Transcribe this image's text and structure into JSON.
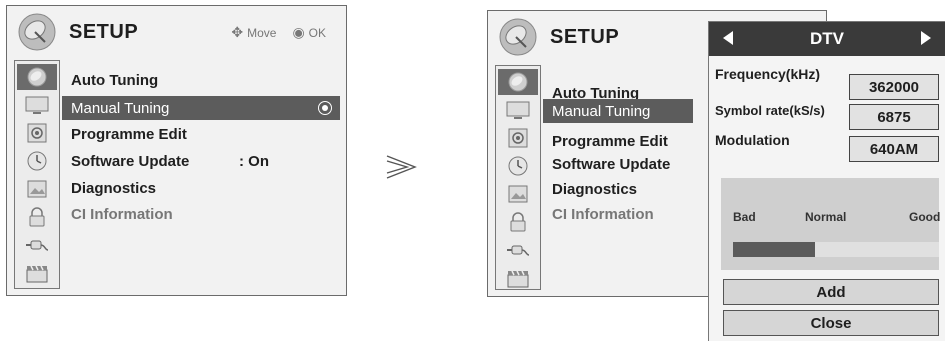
{
  "left_menu": {
    "title": "SETUP",
    "hints": {
      "move_label": "Move",
      "ok_label": "OK"
    },
    "items": [
      {
        "label": "Auto Tuning"
      },
      {
        "label": "Manual Tuning"
      },
      {
        "label": "Programme Edit"
      },
      {
        "label": "Software Update",
        "value": ": On"
      },
      {
        "label": "Diagnostics"
      },
      {
        "label": "CI Information"
      }
    ]
  },
  "right_menu": {
    "title": "SETUP",
    "items": [
      {
        "label": "Auto Tuning"
      },
      {
        "label": "Manual Tuning"
      },
      {
        "label": "Programme Edit"
      },
      {
        "label": "Software Update"
      },
      {
        "label": "Diagnostics"
      },
      {
        "label": "CI Information"
      }
    ]
  },
  "category_icons": [
    "satellite-dish-icon",
    "tv-screen-icon",
    "speaker-icon",
    "clock-icon",
    "picture-icon",
    "lock-icon",
    "connector-icon",
    "clapperboard-icon"
  ],
  "dtv_panel": {
    "mode": "DTV",
    "frequency_label": "Frequency(kHz)",
    "frequency_value": "362000",
    "symbol_rate_label": "Symbol rate(kS/s)",
    "symbol_rate_value": "6875",
    "modulation_label": "Modulation",
    "modulation_value": "640AM",
    "signal": {
      "bad": "Bad",
      "normal": "Normal",
      "good": "Good",
      "level_fraction": 0.4
    },
    "add_label": "Add",
    "close_label": "Close"
  },
  "colors": {
    "selected_row": "#5c5c5c",
    "panel_header": "#3a3a3a",
    "signal_fill": "#5b5b5b"
  }
}
